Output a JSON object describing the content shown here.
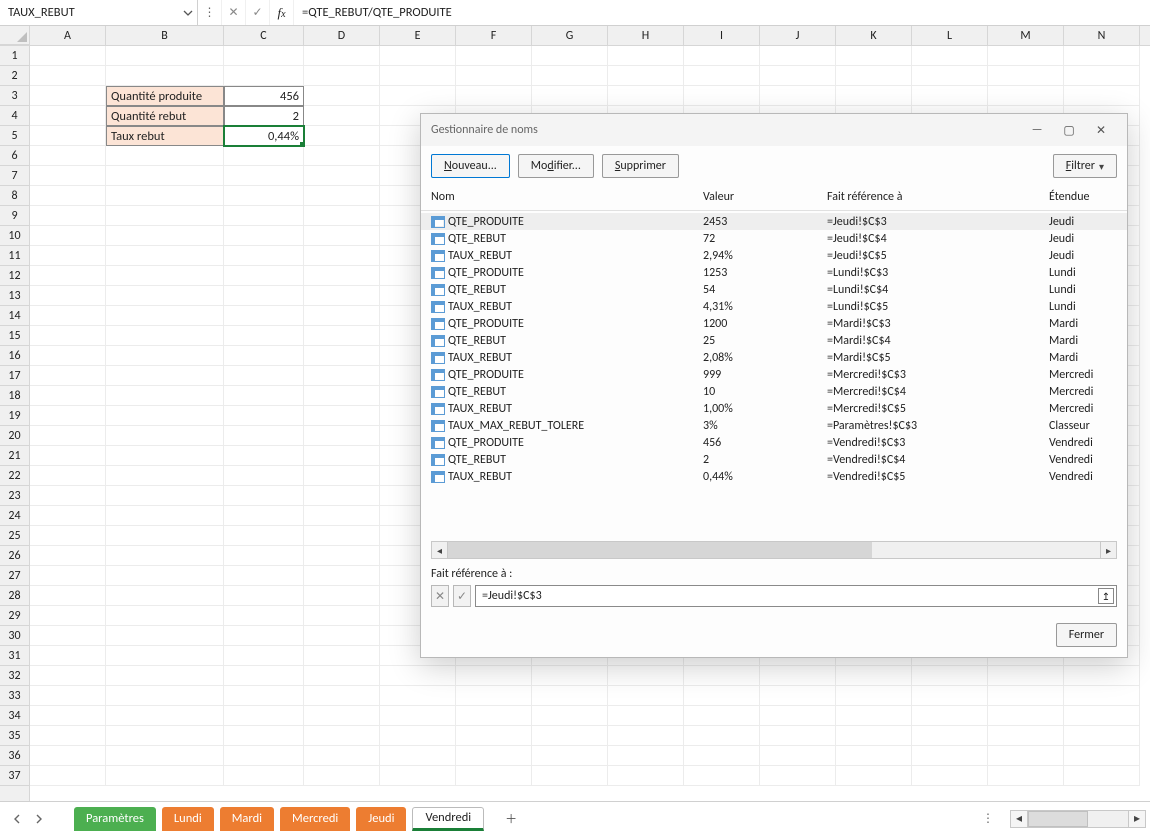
{
  "nameBox": "TAUX_REBUT",
  "formula": "=QTE_REBUT/QTE_PRODUITE",
  "columns": [
    "A",
    "B",
    "C",
    "D",
    "E",
    "F",
    "G",
    "H",
    "I",
    "J",
    "K",
    "L",
    "M",
    "N"
  ],
  "rowCount": 37,
  "sheetCells": {
    "b3": "Quantité produite",
    "c3": "456",
    "b4": "Quantité rebut",
    "c4": "2",
    "b5": "Taux rebut",
    "c5": "0,44%"
  },
  "tabs": [
    {
      "label": "Paramètres",
      "color": "green",
      "active": false
    },
    {
      "label": "Lundi",
      "color": "orange",
      "active": false
    },
    {
      "label": "Mardi",
      "color": "orange",
      "active": false
    },
    {
      "label": "Mercredi",
      "color": "orange",
      "active": false
    },
    {
      "label": "Jeudi",
      "color": "orange",
      "active": false
    },
    {
      "label": "Vendredi",
      "color": "none",
      "active": true
    }
  ],
  "dialog": {
    "title": "Gestionnaire de noms",
    "buttons": {
      "new": "Nouveau...",
      "edit": "Modifier...",
      "delete": "Supprimer",
      "filter": "Filtrer"
    },
    "headers": {
      "name": "Nom",
      "value": "Valeur",
      "ref": "Fait référence à",
      "scope": "Étendue"
    },
    "rows": [
      {
        "name": "QTE_PRODUITE",
        "value": "2453",
        "ref": "=Jeudi!$C$3",
        "scope": "Jeudi",
        "selected": true
      },
      {
        "name": "QTE_REBUT",
        "value": "72",
        "ref": "=Jeudi!$C$4",
        "scope": "Jeudi",
        "selected": false
      },
      {
        "name": "TAUX_REBUT",
        "value": "2,94%",
        "ref": "=Jeudi!$C$5",
        "scope": "Jeudi",
        "selected": false
      },
      {
        "name": "QTE_PRODUITE",
        "value": "1253",
        "ref": "=Lundi!$C$3",
        "scope": "Lundi",
        "selected": false
      },
      {
        "name": "QTE_REBUT",
        "value": "54",
        "ref": "=Lundi!$C$4",
        "scope": "Lundi",
        "selected": false
      },
      {
        "name": "TAUX_REBUT",
        "value": "4,31%",
        "ref": "=Lundi!$C$5",
        "scope": "Lundi",
        "selected": false
      },
      {
        "name": "QTE_PRODUITE",
        "value": "1200",
        "ref": "=Mardi!$C$3",
        "scope": "Mardi",
        "selected": false
      },
      {
        "name": "QTE_REBUT",
        "value": "25",
        "ref": "=Mardi!$C$4",
        "scope": "Mardi",
        "selected": false
      },
      {
        "name": "TAUX_REBUT",
        "value": "2,08%",
        "ref": "=Mardi!$C$5",
        "scope": "Mardi",
        "selected": false
      },
      {
        "name": "QTE_PRODUITE",
        "value": "999",
        "ref": "=Mercredi!$C$3",
        "scope": "Mercredi",
        "selected": false
      },
      {
        "name": "QTE_REBUT",
        "value": "10",
        "ref": "=Mercredi!$C$4",
        "scope": "Mercredi",
        "selected": false
      },
      {
        "name": "TAUX_REBUT",
        "value": "1,00%",
        "ref": "=Mercredi!$C$5",
        "scope": "Mercredi",
        "selected": false
      },
      {
        "name": "TAUX_MAX_REBUT_TOLERE",
        "value": "3%",
        "ref": "=Paramètres!$C$3",
        "scope": "Classeur",
        "selected": false
      },
      {
        "name": "QTE_PRODUITE",
        "value": "456",
        "ref": "=Vendredi!$C$3",
        "scope": "Vendredi",
        "selected": false
      },
      {
        "name": "QTE_REBUT",
        "value": "2",
        "ref": "=Vendredi!$C$4",
        "scope": "Vendredi",
        "selected": false
      },
      {
        "name": "TAUX_REBUT",
        "value": "0,44%",
        "ref": "=Vendredi!$C$5",
        "scope": "Vendredi",
        "selected": false
      }
    ],
    "refLabel": "Fait référence à :",
    "refValue": "=Jeudi!$C$3",
    "closeButton": "Fermer"
  }
}
